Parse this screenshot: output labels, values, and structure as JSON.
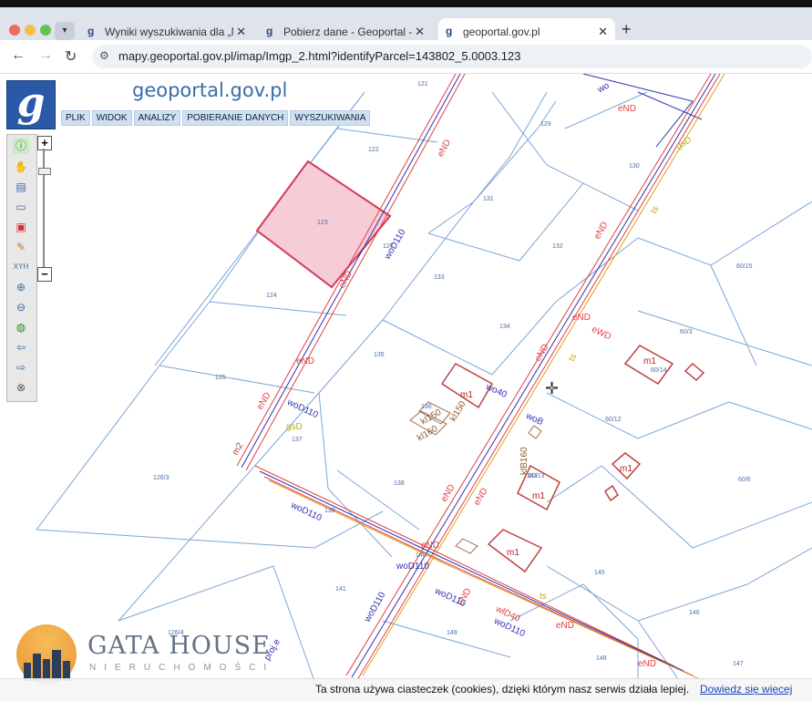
{
  "browser": {
    "tabs": [
      {
        "title": "Wyniki wyszukiwania dla „Ms",
        "active": false
      },
      {
        "title": "Pobierz dane - Geoportal - G",
        "active": false
      },
      {
        "title": "geoportal.gov.pl",
        "active": true
      }
    ],
    "url": "mapy.geoportal.gov.pl/imap/Imgp_2.html?identifyParcel=143802_5.0003.123"
  },
  "app": {
    "brand": "geoportal.gov.pl",
    "logo_letter": "g",
    "menu": [
      "PLIK",
      "WIDOK",
      "ANALIZY",
      "POBIERANIE DANYCH",
      "WYSZUKIWANIA"
    ]
  },
  "map": {
    "parcels": [
      "121",
      "122",
      "123",
      "124",
      "125",
      "126/3",
      "126/4",
      "127",
      "129",
      "130",
      "131",
      "132",
      "133",
      "134",
      "135",
      "136",
      "137",
      "138",
      "139",
      "140",
      "141",
      "143",
      "145",
      "146",
      "147",
      "148",
      "149",
      "60/15",
      "60/3",
      "60/12",
      "60/14",
      "60/6",
      "60/13"
    ],
    "utility_labels": [
      "eND",
      "wo",
      "woD110",
      "gsD",
      "ts",
      "wo40",
      "woB",
      "kl150",
      "kl160",
      "klB160",
      "m1",
      "m2",
      "proj.e",
      "wlD40",
      "eWD",
      "eNA"
    ],
    "selected_parcel": "123"
  },
  "watermark": {
    "name": "GATA HOUSE",
    "sub": "NIERUCHOMOŚCI"
  },
  "cookie": {
    "text": "Ta strona używa ciasteczek (cookies), dzięki którym nasz serwis działa lepiej.",
    "link": "Dowiedz się więcej"
  },
  "colors": {
    "selected_fill": "#f6cdd6",
    "selected_stroke": "#d23a5a",
    "parcel_line": "#7aa6d8",
    "utility_red": "#e04040",
    "utility_blue": "#3030b0",
    "brand_blue": "#2c58a8"
  }
}
